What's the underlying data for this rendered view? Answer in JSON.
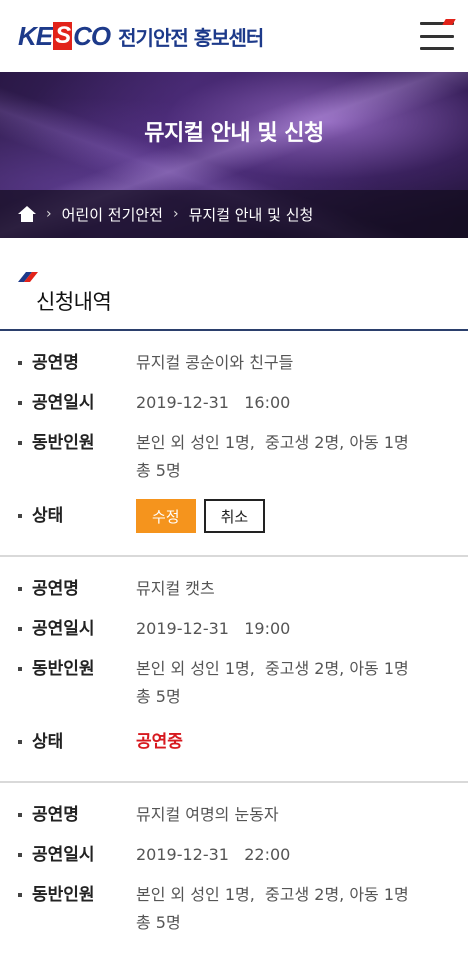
{
  "header": {
    "logo_mark_left": "KE",
    "logo_mark_s": "S",
    "logo_mark_right": "CO",
    "logo_text": "전기안전 홍보센터"
  },
  "banner": {
    "title": "뮤지컬 안내 및 신청",
    "breadcrumb": [
      "어린이 전기안전",
      "뮤지컬 안내 및 신청"
    ]
  },
  "section": {
    "title": "신청내역"
  },
  "labels": {
    "title": "공연명",
    "datetime": "공연일시",
    "companions": "동반인원",
    "status": "상태"
  },
  "entries": [
    {
      "title": "뮤지컬 콩순이와 친구들",
      "datetime": "2019-12-31   16:00",
      "companions_line1": "본인 외 성인 1명,  중고생 2명, 아동 1명",
      "companions_line2": "총 5명",
      "edit_button": "수정",
      "cancel_button": "취소"
    },
    {
      "title": "뮤지컬 캣츠",
      "datetime": "2019-12-31   19:00",
      "companions_line1": "본인 외 성인 1명,  중고생 2명, 아동 1명",
      "companions_line2": "총 5명",
      "status_text": "공연중"
    },
    {
      "title": "뮤지컬 여명의 눈동자",
      "datetime": "2019-12-31   22:00",
      "companions_line1": "본인 외 성인 1명,  중고생 2명, 아동 1명",
      "companions_line2": "총 5명"
    }
  ],
  "colors": {
    "brand_blue": "#1d3a8a",
    "brand_red": "#e2231a",
    "edit_orange": "#f5941d",
    "status_red": "#d7191f"
  }
}
